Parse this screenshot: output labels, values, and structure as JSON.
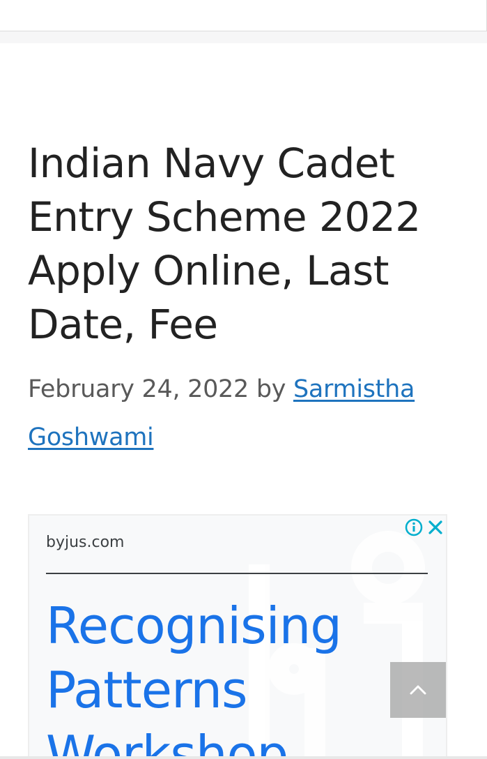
{
  "article": {
    "title": "Indian Navy Cadet Entry Scheme 2022 Apply Online, Last Date, Fee",
    "date": "February 24, 2022",
    "by": "by",
    "author": "Sarmistha Goshwami"
  },
  "ad": {
    "domain": "byjus.com",
    "headline": "Recognising Patterns Workshop",
    "info_icon": "info-icon",
    "close_icon": "close-icon",
    "accent": "#1a73e8"
  },
  "controls": {
    "back_to_top_icon": "chevron-up-icon"
  },
  "colors": {
    "link": "#1e73be",
    "title": "#222222",
    "meta": "#595959"
  }
}
